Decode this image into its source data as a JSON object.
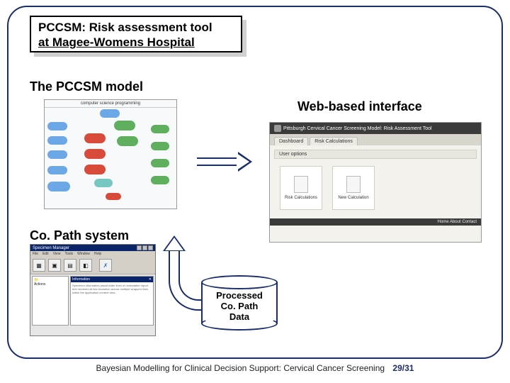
{
  "title": {
    "l1": "PCCSM: Risk assessment tool",
    "l2": "at Magee-Womens Hospital"
  },
  "labels": {
    "model": "The PCCSM model",
    "web": "Web-based interface",
    "copath": "Co. Path system"
  },
  "model_graph": {
    "heading": "computer science programming"
  },
  "web_panel": {
    "brand": "Pittsburgh Cervical Cancer Screening Model: Risk Assessment Tool",
    "tab1": "Dashboard",
    "tab2": "Risk Calculations",
    "section": "User options",
    "card1": "Risk Calculations",
    "card2": "New Calculation",
    "footer": "Home  About  Contact"
  },
  "copath": {
    "title": "Specimen Manager",
    "menu": [
      "File",
      "Edit",
      "View",
      "Tools",
      "Window",
      "Help"
    ],
    "tree_root": "Actions"
  },
  "cylinder": {
    "l1": "Processed",
    "l2": "Co. Path",
    "l3": "Data"
  },
  "footer": {
    "text": "Bayesian Modelling for Clinical Decision Support: Cervical Cancer Screening",
    "page": "29/31"
  }
}
